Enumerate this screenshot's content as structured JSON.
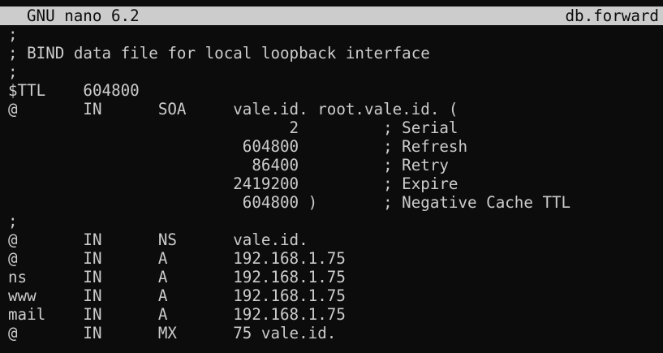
{
  "title_bar": {
    "app_name": "GNU nano 6.2",
    "file_name": "db.forward"
  },
  "colors": {
    "background": "#0c0c0c",
    "foreground": "#cccccc",
    "title_bar_background": "#cccccc",
    "title_bar_foreground": "#0c0c0c"
  },
  "buffer": {
    "lines": [
      ";",
      "; BIND data file for local loopback interface",
      ";",
      "$TTL    604800",
      "@       IN      SOA     vale.id. root.vale.id. (",
      "                              2         ; Serial",
      "                         604800         ; Refresh",
      "                          86400         ; Retry",
      "                        2419200         ; Expire",
      "                         604800 )       ; Negative Cache TTL",
      ";",
      "@       IN      NS      vale.id.",
      "@       IN      A       192.168.1.75",
      "ns      IN      A       192.168.1.75",
      "www     IN      A       192.168.1.75",
      "mail    IN      A       192.168.1.75",
      "@       IN      MX      75 vale.id."
    ]
  }
}
